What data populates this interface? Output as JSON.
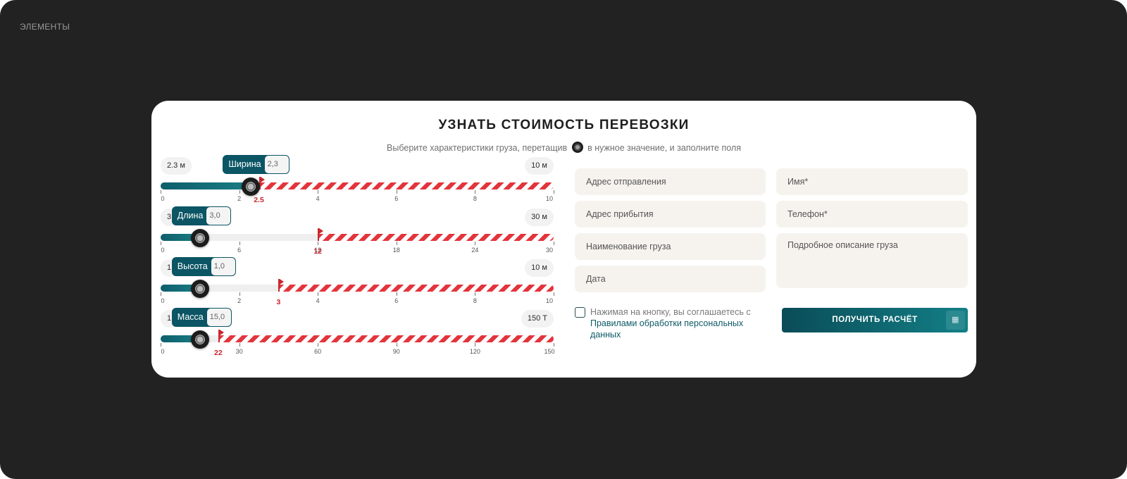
{
  "page": {
    "section_label": "ЭЛЕМЕНТЫ"
  },
  "calculator": {
    "title": "УЗНАТЬ СТОИМОСТЬ ПЕРЕВОЗКИ",
    "subtitle_before": "Выберите характеристики груза, перетащив",
    "subtitle_after": "в нужное значение, и заполните поля",
    "sliders": [
      {
        "label": "Ширина",
        "value": "2,3",
        "min_display": "2.3 м",
        "max_display": "10 м",
        "min": 0,
        "max": 10,
        "current": 2.3,
        "limit": 2.5,
        "limit_label": "2.5",
        "ticks": [
          "0",
          "2",
          "4",
          "6",
          "8",
          "10"
        ],
        "tick_values": [
          0,
          2,
          4,
          6,
          8,
          10
        ]
      },
      {
        "label": "Длина",
        "value": "3,0",
        "min_display": "3",
        "max_display": "30 м",
        "min": 0,
        "max": 30,
        "current": 3.0,
        "limit": 12,
        "limit_label": "12",
        "ticks": [
          "0",
          "6",
          "12",
          "18",
          "24",
          "30"
        ],
        "tick_values": [
          0,
          6,
          12,
          18,
          24,
          30
        ]
      },
      {
        "label": "Высота",
        "value": "1,0",
        "min_display": "1",
        "max_display": "10 м",
        "min": 0,
        "max": 10,
        "current": 1.0,
        "limit": 3,
        "limit_label": "3",
        "ticks": [
          "0",
          "2",
          "4",
          "6",
          "8",
          "10"
        ],
        "tick_values": [
          0,
          2,
          4,
          6,
          8,
          10
        ]
      },
      {
        "label": "Масса",
        "value": "15,0",
        "min_display": "1",
        "max_display": "150 Т",
        "min": 0,
        "max": 150,
        "current": 15.0,
        "limit": 22,
        "limit_label": "22",
        "ticks": [
          "0",
          "30",
          "60",
          "90",
          "120",
          "150"
        ],
        "tick_values": [
          0,
          30,
          60,
          90,
          120,
          150
        ]
      }
    ],
    "form": {
      "from_placeholder": "Адрес отправления",
      "to_placeholder": "Адрес прибытия",
      "cargo_name_placeholder": "Наименование груза",
      "date_placeholder": "Дата",
      "name_placeholder": "Имя*",
      "phone_placeholder": "Телефон*",
      "description_placeholder": "Подробное описание груза",
      "consent_text": "Нажимая на кнопку, вы соглашаетесь с",
      "consent_link": "Правилами обработки персональных данных",
      "consent_checked": false,
      "submit_label": "ПОЛУЧИТЬ РАСЧЁТ",
      "submit_icon": "calculator-icon"
    }
  }
}
